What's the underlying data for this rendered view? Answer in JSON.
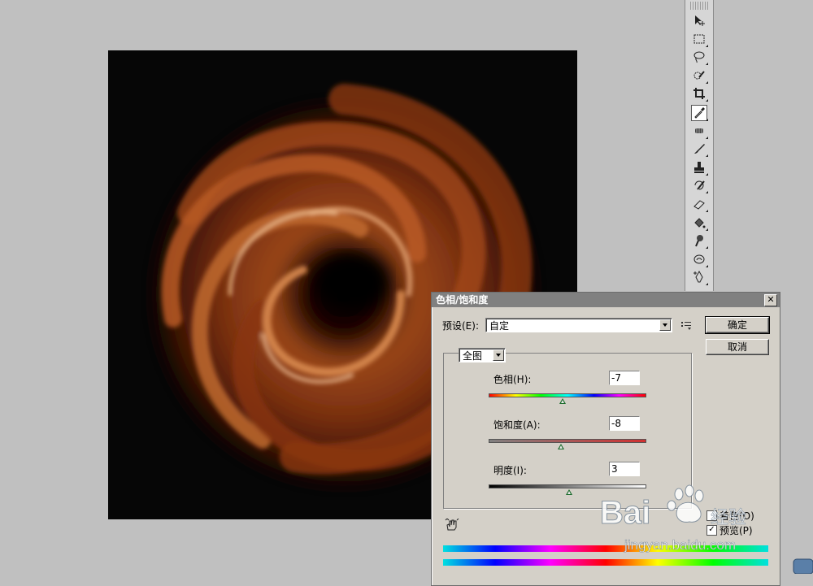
{
  "dialog": {
    "title": "色相/饱和度",
    "close_glyph": "✕",
    "preset_label": "预设(E):",
    "preset_value": "自定",
    "ok_label": "确定",
    "cancel_label": "取消",
    "channel_value": "全图",
    "hue": {
      "label": "色相(H):",
      "value": "-7",
      "slider_level": 0.47
    },
    "saturation": {
      "label": "饱和度(A):",
      "value": "-8",
      "slider_level": 0.46
    },
    "lightness": {
      "label": "明度(I):",
      "value": "3",
      "slider_level": 0.51
    },
    "colorize_label": "着色(O)",
    "preview_label": "预览(P)",
    "preview_checked": true
  },
  "toolbox": {
    "tools": [
      {
        "name": "move-tool-icon",
        "has_submenu": false
      },
      {
        "name": "marquee-tool-icon",
        "has_submenu": true
      },
      {
        "name": "lasso-tool-icon",
        "has_submenu": true
      },
      {
        "name": "quick-select-tool-icon",
        "has_submenu": true
      },
      {
        "name": "crop-tool-icon",
        "has_submenu": true
      },
      {
        "name": "eyedropper-tool-icon",
        "has_submenu": true,
        "active": true
      },
      {
        "name": "healing-brush-tool-icon",
        "has_submenu": true
      },
      {
        "name": "brush-tool-icon",
        "has_submenu": true
      },
      {
        "name": "clone-stamp-tool-icon",
        "has_submenu": true
      },
      {
        "name": "history-brush-tool-icon",
        "has_submenu": true
      },
      {
        "name": "eraser-tool-icon",
        "has_submenu": true
      },
      {
        "name": "paint-bucket-tool-icon",
        "has_submenu": true
      },
      {
        "name": "dodge-tool-icon",
        "has_submenu": true
      },
      {
        "name": "blur-tool-icon",
        "has_submenu": true
      },
      {
        "name": "pen-tool-icon",
        "has_submenu": true
      }
    ]
  },
  "watermark": {
    "brand": "Bai",
    "brand2": "经验",
    "url": "jingyan.baidu.com"
  },
  "colors": {
    "workspace_bg": "#c0c0c0",
    "canvas_bg": "#060606",
    "swirl": "#8a3a12",
    "dialog_bg": "#d4d0c8",
    "title_bar": "#808080"
  }
}
